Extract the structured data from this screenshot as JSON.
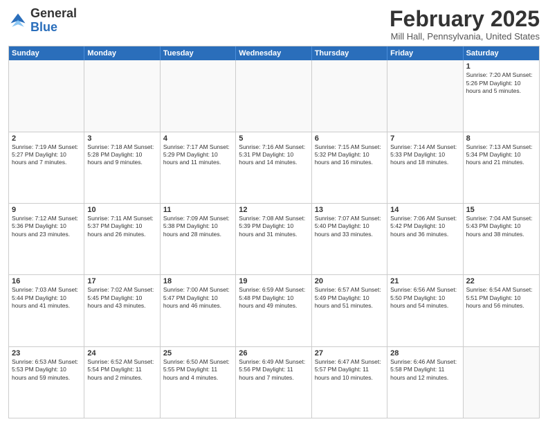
{
  "header": {
    "logo": {
      "general": "General",
      "blue": "Blue"
    },
    "title": "February 2025",
    "location": "Mill Hall, Pennsylvania, United States"
  },
  "calendar": {
    "days_of_week": [
      "Sunday",
      "Monday",
      "Tuesday",
      "Wednesday",
      "Thursday",
      "Friday",
      "Saturday"
    ],
    "rows": [
      [
        {
          "day": "",
          "info": "",
          "empty": true
        },
        {
          "day": "",
          "info": "",
          "empty": true
        },
        {
          "day": "",
          "info": "",
          "empty": true
        },
        {
          "day": "",
          "info": "",
          "empty": true
        },
        {
          "day": "",
          "info": "",
          "empty": true
        },
        {
          "day": "",
          "info": "",
          "empty": true
        },
        {
          "day": "1",
          "info": "Sunrise: 7:20 AM\nSunset: 5:26 PM\nDaylight: 10 hours\nand 5 minutes."
        }
      ],
      [
        {
          "day": "2",
          "info": "Sunrise: 7:19 AM\nSunset: 5:27 PM\nDaylight: 10 hours\nand 7 minutes."
        },
        {
          "day": "3",
          "info": "Sunrise: 7:18 AM\nSunset: 5:28 PM\nDaylight: 10 hours\nand 9 minutes."
        },
        {
          "day": "4",
          "info": "Sunrise: 7:17 AM\nSunset: 5:29 PM\nDaylight: 10 hours\nand 11 minutes."
        },
        {
          "day": "5",
          "info": "Sunrise: 7:16 AM\nSunset: 5:31 PM\nDaylight: 10 hours\nand 14 minutes."
        },
        {
          "day": "6",
          "info": "Sunrise: 7:15 AM\nSunset: 5:32 PM\nDaylight: 10 hours\nand 16 minutes."
        },
        {
          "day": "7",
          "info": "Sunrise: 7:14 AM\nSunset: 5:33 PM\nDaylight: 10 hours\nand 18 minutes."
        },
        {
          "day": "8",
          "info": "Sunrise: 7:13 AM\nSunset: 5:34 PM\nDaylight: 10 hours\nand 21 minutes."
        }
      ],
      [
        {
          "day": "9",
          "info": "Sunrise: 7:12 AM\nSunset: 5:36 PM\nDaylight: 10 hours\nand 23 minutes."
        },
        {
          "day": "10",
          "info": "Sunrise: 7:11 AM\nSunset: 5:37 PM\nDaylight: 10 hours\nand 26 minutes."
        },
        {
          "day": "11",
          "info": "Sunrise: 7:09 AM\nSunset: 5:38 PM\nDaylight: 10 hours\nand 28 minutes."
        },
        {
          "day": "12",
          "info": "Sunrise: 7:08 AM\nSunset: 5:39 PM\nDaylight: 10 hours\nand 31 minutes."
        },
        {
          "day": "13",
          "info": "Sunrise: 7:07 AM\nSunset: 5:40 PM\nDaylight: 10 hours\nand 33 minutes."
        },
        {
          "day": "14",
          "info": "Sunrise: 7:06 AM\nSunset: 5:42 PM\nDaylight: 10 hours\nand 36 minutes."
        },
        {
          "day": "15",
          "info": "Sunrise: 7:04 AM\nSunset: 5:43 PM\nDaylight: 10 hours\nand 38 minutes."
        }
      ],
      [
        {
          "day": "16",
          "info": "Sunrise: 7:03 AM\nSunset: 5:44 PM\nDaylight: 10 hours\nand 41 minutes."
        },
        {
          "day": "17",
          "info": "Sunrise: 7:02 AM\nSunset: 5:45 PM\nDaylight: 10 hours\nand 43 minutes."
        },
        {
          "day": "18",
          "info": "Sunrise: 7:00 AM\nSunset: 5:47 PM\nDaylight: 10 hours\nand 46 minutes."
        },
        {
          "day": "19",
          "info": "Sunrise: 6:59 AM\nSunset: 5:48 PM\nDaylight: 10 hours\nand 49 minutes."
        },
        {
          "day": "20",
          "info": "Sunrise: 6:57 AM\nSunset: 5:49 PM\nDaylight: 10 hours\nand 51 minutes."
        },
        {
          "day": "21",
          "info": "Sunrise: 6:56 AM\nSunset: 5:50 PM\nDaylight: 10 hours\nand 54 minutes."
        },
        {
          "day": "22",
          "info": "Sunrise: 6:54 AM\nSunset: 5:51 PM\nDaylight: 10 hours\nand 56 minutes."
        }
      ],
      [
        {
          "day": "23",
          "info": "Sunrise: 6:53 AM\nSunset: 5:53 PM\nDaylight: 10 hours\nand 59 minutes."
        },
        {
          "day": "24",
          "info": "Sunrise: 6:52 AM\nSunset: 5:54 PM\nDaylight: 11 hours\nand 2 minutes."
        },
        {
          "day": "25",
          "info": "Sunrise: 6:50 AM\nSunset: 5:55 PM\nDaylight: 11 hours\nand 4 minutes."
        },
        {
          "day": "26",
          "info": "Sunrise: 6:49 AM\nSunset: 5:56 PM\nDaylight: 11 hours\nand 7 minutes."
        },
        {
          "day": "27",
          "info": "Sunrise: 6:47 AM\nSunset: 5:57 PM\nDaylight: 11 hours\nand 10 minutes."
        },
        {
          "day": "28",
          "info": "Sunrise: 6:46 AM\nSunset: 5:58 PM\nDaylight: 11 hours\nand 12 minutes."
        },
        {
          "day": "",
          "info": "",
          "empty": true
        }
      ]
    ]
  }
}
